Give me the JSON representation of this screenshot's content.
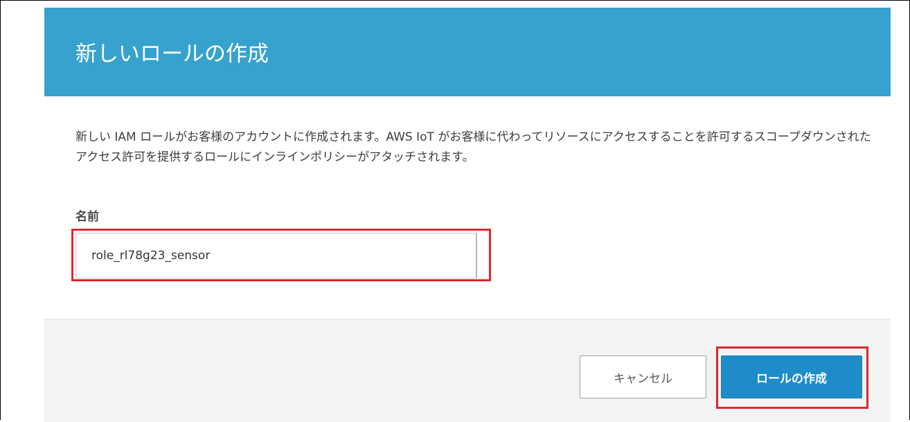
{
  "dialog": {
    "title": "新しいロールの作成",
    "description": "新しい IAM ロールがお客様のアカウントに作成されます。AWS IoT がお客様に代わってリソースにアクセスすることを許可するスコープダウンされたアクセス許可を提供するロールにインラインポリシーがアタッチされます。",
    "name_field": {
      "label": "名前",
      "value": "role_rl78g23_sensor"
    },
    "footer": {
      "cancel_label": "キャンセル",
      "create_label": "ロールの作成"
    }
  },
  "colors": {
    "header_bg": "#36a2cd",
    "primary_button": "#1e8cc9",
    "highlight_annotation": "#e3262d",
    "footer_bg": "#f2f3f3"
  }
}
